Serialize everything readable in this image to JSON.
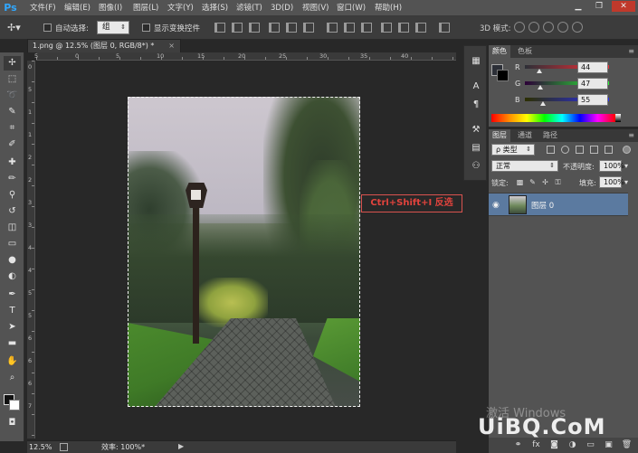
{
  "app": {
    "logo": "Ps"
  },
  "menu": [
    "文件(F)",
    "编辑(E)",
    "图像(I)",
    "图层(L)",
    "文字(Y)",
    "选择(S)",
    "滤镜(T)",
    "3D(D)",
    "视图(V)",
    "窗口(W)",
    "帮助(H)"
  ],
  "window_controls": {
    "minimize": "▁",
    "maximize": "❐",
    "close": "✕"
  },
  "options": {
    "auto_select_label": "自动选择:",
    "auto_select_value": "组",
    "show_transform_label": "显示变换控件",
    "mode_3d_label": "3D 模式:"
  },
  "document": {
    "tab_title": "1.png @ 12.5% (图层 0, RGB/8*) *",
    "tab_close": "×",
    "ruler_top": [
      "5",
      "0",
      "5",
      "10",
      "15",
      "20",
      "25",
      "30",
      "35",
      "40"
    ],
    "ruler_left": [
      "0",
      "5",
      "1",
      "1",
      "2",
      "2",
      "3",
      "3",
      "4",
      "4",
      "5",
      "5",
      "6",
      "6",
      "6",
      "7"
    ]
  },
  "annotation": {
    "text": "Ctrl+Shift+I 反选"
  },
  "status": {
    "zoom": "12.5%",
    "efficiency": "效率: 100%*",
    "arrow": "▶"
  },
  "color_panel": {
    "tabs": [
      "颜色",
      "色板"
    ],
    "channels": [
      {
        "label": "R",
        "value": "44",
        "fraction": 0.17,
        "gradient": "linear-gradient(90deg,#2c2f37,#ff2f37)"
      },
      {
        "label": "G",
        "value": "47",
        "fraction": 0.18,
        "gradient": "linear-gradient(90deg,#2c0037,#2cff37)"
      },
      {
        "label": "B",
        "value": "55",
        "fraction": 0.22,
        "gradient": "linear-gradient(90deg,#2c2f00,#2c2fff)"
      }
    ]
  },
  "layers_panel": {
    "tabs": [
      "图层",
      "通道",
      "路径"
    ],
    "filter_kind": "ρ 类型",
    "blend_mode": "正常",
    "opacity_label": "不透明度:",
    "opacity_value": "100%",
    "lock_label": "锁定:",
    "fill_label": "填充:",
    "fill_value": "100%",
    "layer_name": "图层 0"
  },
  "watermark": {
    "windows": "激活 Windows",
    "site": "UiBQ.CoM"
  }
}
